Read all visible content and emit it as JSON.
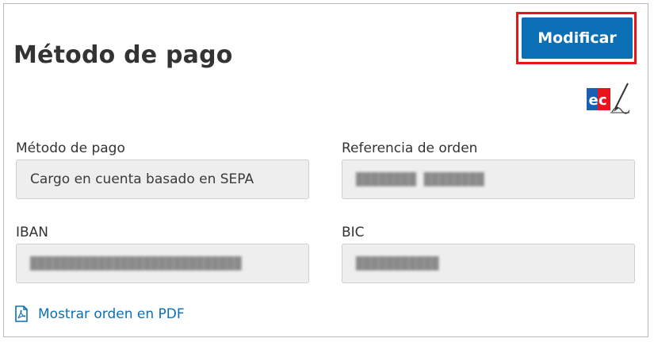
{
  "section": {
    "title": "Método de pago",
    "modify_label": "Modificar"
  },
  "icons": {
    "ec_logo": "ec-cash-signature-icon",
    "pdf": "pdf-document-icon"
  },
  "fields": {
    "payment_method": {
      "label": "Método de pago",
      "value": "Cargo en cuenta basado en SEPA"
    },
    "order_reference": {
      "label": "Referencia de orden",
      "value": "████████ ████████"
    },
    "iban": {
      "label": "IBAN",
      "value": "████████████████████████████"
    },
    "bic": {
      "label": "BIC",
      "value": "███████████"
    }
  },
  "pdf_link": {
    "label": "Mostrar orden en PDF"
  },
  "colors": {
    "accent": "#0a6fb4",
    "highlight": "#e8141b",
    "field_bg": "#eeeeee"
  }
}
